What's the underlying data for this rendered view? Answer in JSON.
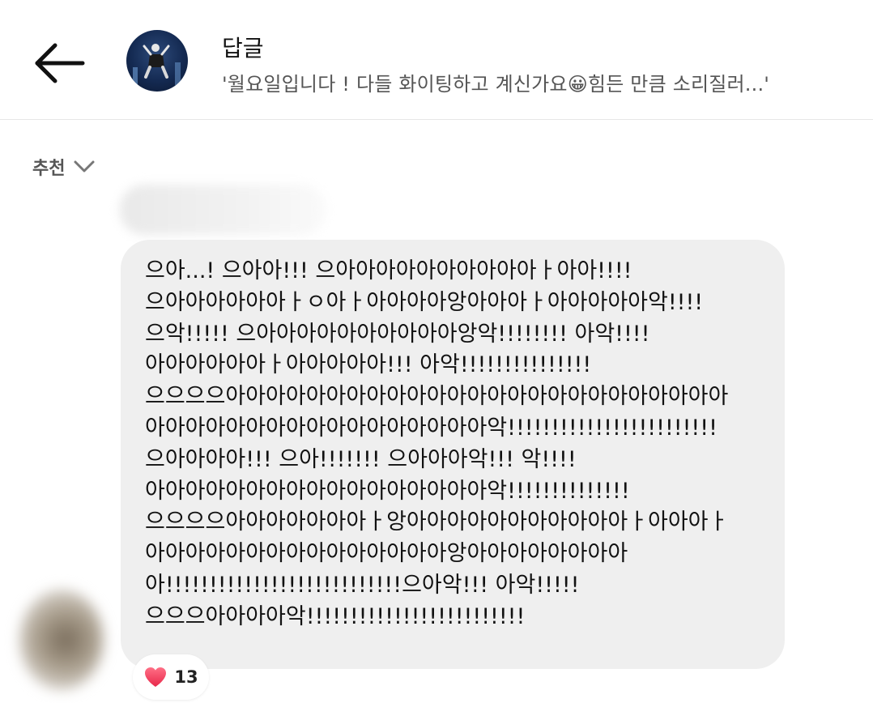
{
  "header": {
    "back_icon": "arrow-left-icon",
    "title": "답글",
    "subtitle": "'월요일입니다 ! 다들 화이팅하고 계신가요😀힘든 만큼 소리질러...'"
  },
  "sort": {
    "label": "추천",
    "icon": "chevron-down-icon"
  },
  "comment": {
    "lines": [
      "으아...! 으아아!!! 으아아아아아아아아아아ㅏ아아!!!!",
      "으아아아아아아ㅏㅇ아ㅏ아아아아앙아아아ㅏ아아아아아악!!!!",
      "으악!!!!! 으아아아아아아아아아아앙악!!!!!!!! 아악!!!!",
      "아아아아아아ㅏ아아아아아!!! 아악!!!!!!!!!!!!!!!",
      "으으으으아아아아아아아아아아아아아아아아아아아아아아아아아",
      "아아아아아아아아아아아아아아아아아악!!!!!!!!!!!!!!!!!!!!!!!!",
      "으아아아아!!! 으아!!!!!!! 으아아아악!!! 악!!!!",
      "아아아아아아아아아아아아아아아아아악!!!!!!!!!!!!!!",
      "으으으으아아아아아아아ㅏ앙아아아아아아아아아아아ㅏ아아아ㅏ",
      "아아아아아아아아아아아아아아아앙아아아아아아아아",
      "아!!!!!!!!!!!!!!!!!!!!!!!!!!!으아악!!! 아악!!!!!",
      "으으으아아아아악!!!!!!!!!!!!!!!!!!!!!!!!!"
    ]
  },
  "reaction": {
    "icon": "heart-icon",
    "count": "13"
  },
  "colors": {
    "bubble_bg": "#efefef",
    "heart": "#f2475f",
    "subtitle_text": "#555555"
  }
}
